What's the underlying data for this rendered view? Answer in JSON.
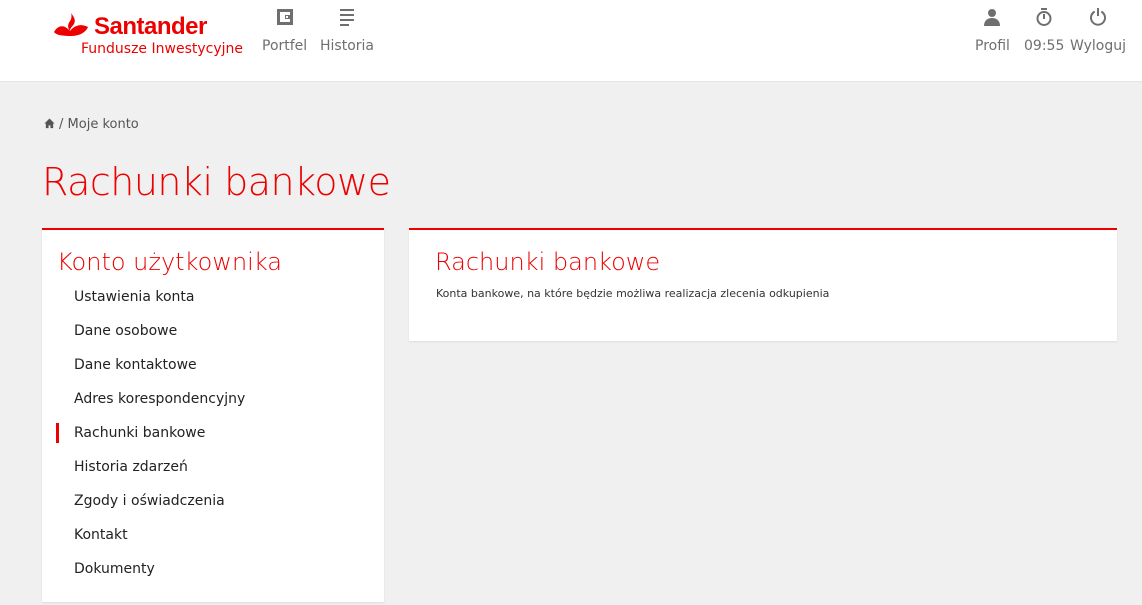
{
  "header": {
    "brand": "Santander",
    "subbrand": "Fundusze Inwestycyjne",
    "accent_color": "#ec0000",
    "nav": [
      {
        "label": "Portfel",
        "icon": "wallet-icon"
      },
      {
        "label": "Historia",
        "icon": "list-icon"
      }
    ],
    "right": [
      {
        "label": "Profil",
        "icon": "user-icon"
      },
      {
        "label": "09:55",
        "icon": "stopwatch-icon"
      },
      {
        "label": "Wyloguj",
        "icon": "power-icon"
      }
    ]
  },
  "breadcrumb": {
    "separator": "/",
    "current": "Moje konto"
  },
  "page_title": "Rachunki bankowe",
  "sidebar": {
    "title": "Konto użytkownika",
    "items": [
      {
        "label": "Ustawienia konta"
      },
      {
        "label": "Dane osobowe"
      },
      {
        "label": "Dane kontaktowe"
      },
      {
        "label": "Adres korespondencyjny"
      },
      {
        "label": "Rachunki bankowe",
        "active": true
      },
      {
        "label": "Historia zdarzeń"
      },
      {
        "label": "Zgody i oświadczenia"
      },
      {
        "label": "Kontakt"
      },
      {
        "label": "Dokumenty"
      }
    ]
  },
  "content": {
    "title": "Rachunki bankowe",
    "description": "Konta bankowe, na które będzie możliwa realizacja zlecenia odkupienia"
  }
}
